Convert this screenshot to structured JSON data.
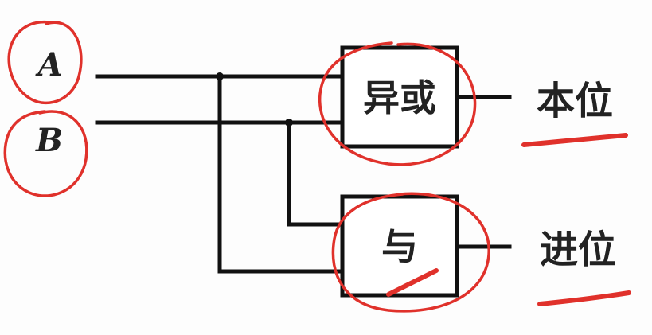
{
  "inputs": {
    "a": "A",
    "b": "B"
  },
  "gates": {
    "xor": "异或",
    "and": "与"
  },
  "outputs": {
    "sum": "本位",
    "carry": "进位"
  },
  "colors": {
    "line": "#111111",
    "annotation": "#e0312b",
    "text": "#222222"
  }
}
